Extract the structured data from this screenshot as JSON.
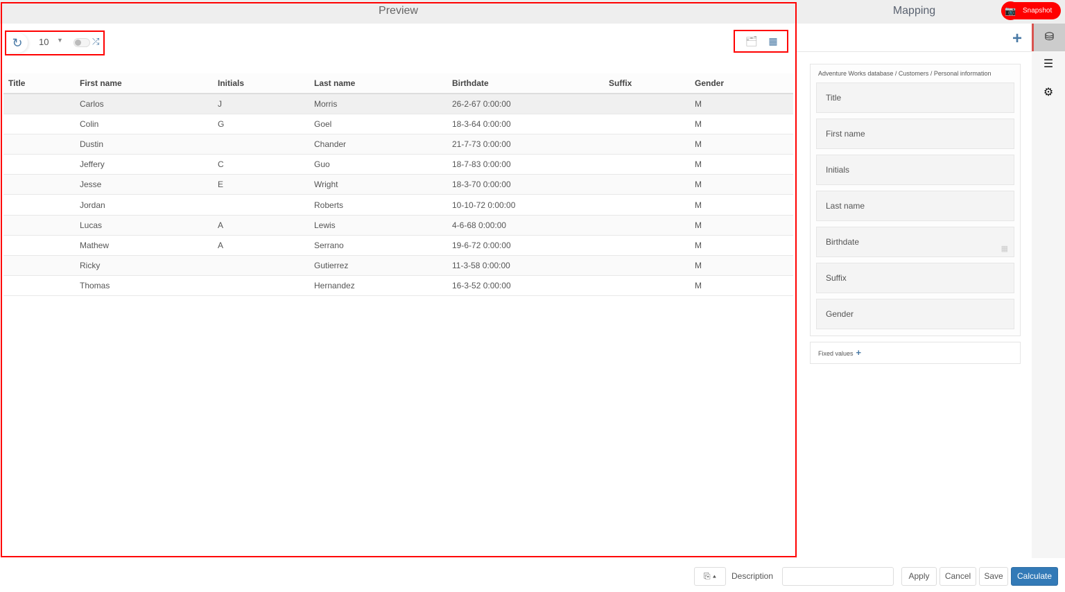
{
  "preview": {
    "title": "Preview",
    "page_size": "10",
    "shuffle_enabled": false,
    "columns": [
      "Title",
      "First name",
      "Initials",
      "Last name",
      "Birthdate",
      "Suffix",
      "Gender"
    ],
    "rows": [
      [
        "",
        "Carlos",
        "J",
        "Morris",
        "26-2-67 0:00:00",
        "",
        "M"
      ],
      [
        "",
        "Colin",
        "G",
        "Goel",
        "18-3-64 0:00:00",
        "",
        "M"
      ],
      [
        "",
        "Dustin",
        "",
        "Chander",
        "21-7-73 0:00:00",
        "",
        "M"
      ],
      [
        "",
        "Jeffery",
        "C",
        "Guo",
        "18-7-83 0:00:00",
        "",
        "M"
      ],
      [
        "",
        "Jesse",
        "E",
        "Wright",
        "18-3-70 0:00:00",
        "",
        "M"
      ],
      [
        "",
        "Jordan",
        "",
        "Roberts",
        "10-10-72 0:00:00",
        "",
        "M"
      ],
      [
        "",
        "Lucas",
        "A",
        "Lewis",
        "4-6-68 0:00:00",
        "",
        "M"
      ],
      [
        "",
        "Mathew",
        "A",
        "Serrano",
        "19-6-72 0:00:00",
        "",
        "M"
      ],
      [
        "",
        "Ricky",
        "",
        "Gutierrez",
        "11-3-58 0:00:00",
        "",
        "M"
      ],
      [
        "",
        "Thomas",
        "",
        "Hernandez",
        "16-3-52 0:00:00",
        "",
        "M"
      ]
    ]
  },
  "mapping": {
    "title": "Mapping",
    "snapshot_label": "Snapshot",
    "breadcrumb": "Adventure Works database / Customers / Personal information",
    "fields": [
      "Title",
      "First name",
      "Initials",
      "Last name",
      "Birthdate",
      "Suffix",
      "Gender"
    ],
    "fixed_values_label": "Fixed values"
  },
  "footer": {
    "description_label": "Description",
    "description_value": "",
    "apply": "Apply",
    "cancel": "Cancel",
    "save": "Save",
    "calculate": "Calculate"
  }
}
